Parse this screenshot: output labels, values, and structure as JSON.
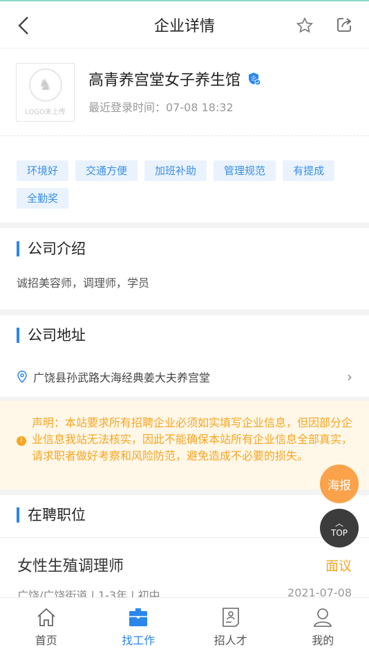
{
  "header": {
    "title": "企业详情",
    "back_icon": "chevron-left-icon",
    "favorite_icon": "star-icon",
    "share_icon": "share-icon"
  },
  "company": {
    "logo_text": "LOGO未上传",
    "name": "高青养宫堂女子养生馆",
    "verified_badge": "企",
    "last_login": "最近登录时间：07-08 18:32"
  },
  "tags": [
    "环境好",
    "交通方便",
    "加班补助",
    "管理规范",
    "有提成",
    "全勤奖"
  ],
  "intro": {
    "title": "公司介绍",
    "text": "诚招美容师，调理师，学员"
  },
  "address": {
    "title": "公司地址",
    "text": "广饶县孙武路大海经典姜大夫养宫堂"
  },
  "notice": {
    "icon": "!",
    "text": "声明：本站要求所有招聘企业必须如实填写企业信息，但因部分企业信息我站无法核实，因此不能确保本站所有企业信息全部真实，请求职者做好考察和风险防范，避免造成不必要的损失。"
  },
  "float": {
    "poster": "海报",
    "top": "TOP"
  },
  "jobs": {
    "title": "在聘职位",
    "items": [
      {
        "title": "女性生殖调理师",
        "salary": "面议",
        "meta": "广饶/广饶街道 | 1-3年 | 初中",
        "date": "2021-07-08"
      }
    ]
  },
  "nav": [
    {
      "label": "首页",
      "icon": "home-icon"
    },
    {
      "label": "找工作",
      "icon": "briefcase-icon",
      "active": true
    },
    {
      "label": "招人才",
      "icon": "resume-icon"
    },
    {
      "label": "我的",
      "icon": "user-icon"
    }
  ],
  "colors": {
    "accent": "#2b86ec",
    "orange": "#f5a623",
    "notice_bg": "#fff7e8"
  }
}
